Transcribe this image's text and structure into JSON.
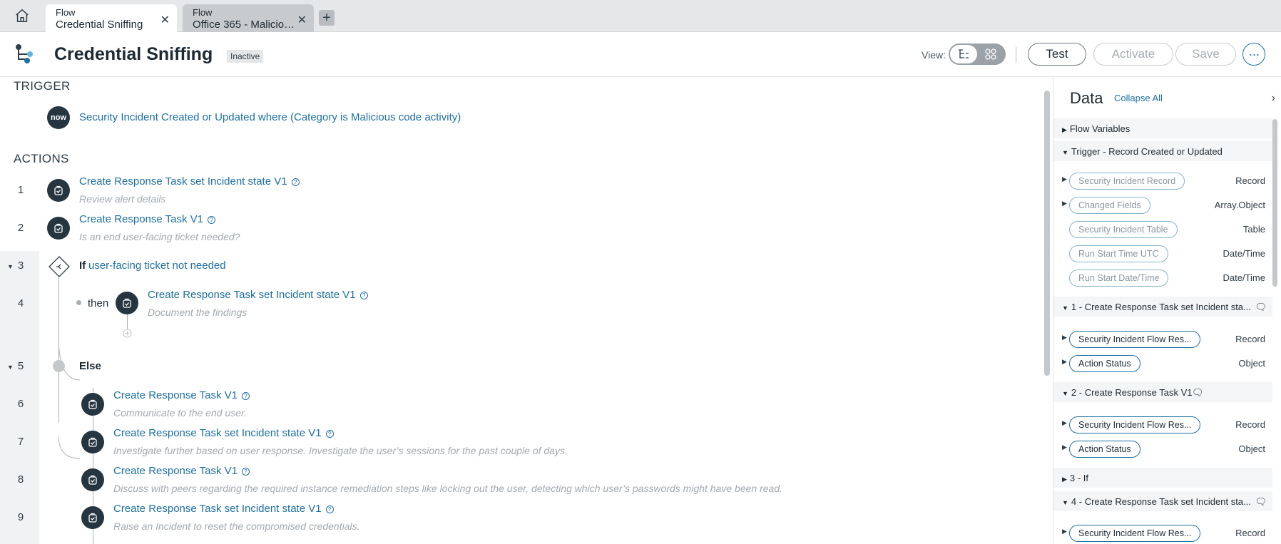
{
  "tabs": [
    {
      "kind": "Flow",
      "name": "Credential Sniffing"
    },
    {
      "kind": "Flow",
      "name": "Office 365 - Malicious code activity"
    }
  ],
  "header": {
    "title": "Credential Sniffing",
    "status": "Inactive",
    "view_label": "View:",
    "test": "Test",
    "activate": "Activate",
    "save": "Save"
  },
  "trigger": {
    "section": "TRIGGER",
    "badge": "now",
    "text": "Security Incident Created or Updated where (Category is Malicious code activity)"
  },
  "actions": {
    "section": "ACTIONS",
    "rows": [
      {
        "num": "1",
        "title": "Create Response Task set Incident state V1",
        "sub": "Review alert details"
      },
      {
        "num": "2",
        "title": "Create Response Task V1",
        "sub": "Is an end user-facing ticket needed?"
      },
      {
        "num": "3",
        "if_label": "If",
        "title": "user-facing ticket not needed"
      },
      {
        "num": "4",
        "then_label": "then",
        "title": "Create Response Task set Incident state V1",
        "sub": "Document the findings"
      },
      {
        "num": "5",
        "title": "Else"
      },
      {
        "num": "6",
        "title": "Create Response Task V1",
        "sub": "Communicate to the end user."
      },
      {
        "num": "7",
        "title": "Create Response Task set Incident state V1",
        "sub": "Investigate further based on user response. Investigate the user’s sessions for the past couple of days."
      },
      {
        "num": "8",
        "title": "Create Response Task V1",
        "sub": "Discuss with peers regarding the required instance remediation steps like locking out the user, detecting which user’s passwords might have been read."
      },
      {
        "num": "9",
        "title": "Create Response Task set Incident state V1",
        "sub": "Raise an Incident to reset the compromised credentials."
      }
    ]
  },
  "panel": {
    "title": "Data",
    "collapse_all": "Collapse All",
    "groups": [
      {
        "label": "Flow Variables"
      },
      {
        "label": "Trigger - Record Created or Updated"
      },
      {
        "label": "1 - Create Response Task set Incident sta..."
      },
      {
        "label": "2 - Create Response Task V1"
      },
      {
        "label": "3 - If"
      },
      {
        "label": "4 - Create Response Task set Incident sta..."
      }
    ],
    "trigger_pills": [
      {
        "name": "Security Incident Record",
        "type": "Record"
      },
      {
        "name": "Changed Fields",
        "type": "Array.Object"
      },
      {
        "name": "Security Incident Table",
        "type": "Table"
      },
      {
        "name": "Run Start Time UTC",
        "type": "Date/Time"
      },
      {
        "name": "Run Start Date/Time",
        "type": "Date/Time"
      }
    ],
    "step1_pills": [
      {
        "name": "Security Incident Flow Res...",
        "type": "Record"
      },
      {
        "name": "Action Status",
        "type": "Object"
      }
    ],
    "step2_pills": [
      {
        "name": "Security Incident Flow Res...",
        "type": "Record"
      },
      {
        "name": "Action Status",
        "type": "Object"
      }
    ],
    "step4_pills": [
      {
        "name": "Security Incident Flow Res...",
        "type": "Record"
      }
    ]
  }
}
